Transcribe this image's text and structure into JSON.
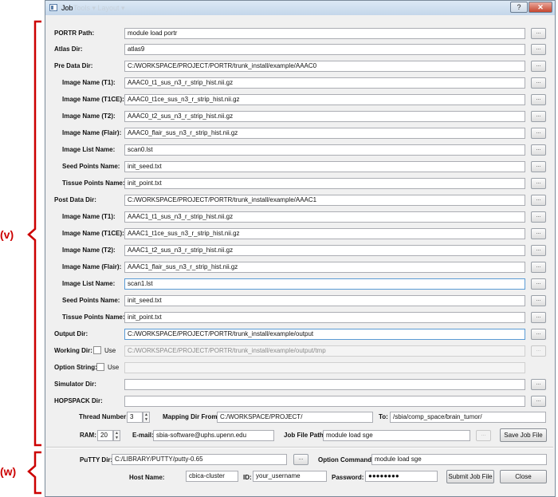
{
  "window": {
    "title": "Job",
    "ghost_menu": "Tools ▾  Layout ▾",
    "help_btn": "?",
    "close_btn": "✕"
  },
  "annotations": {
    "v": "(v)",
    "w": "(w)"
  },
  "browse_label": "...",
  "portr_path": {
    "label": "PORTR Path:",
    "value": "module load portr"
  },
  "atlas_dir": {
    "label": "Atlas Dir:",
    "value": "atlas9"
  },
  "pre_data": {
    "label": "Pre Data Dir:",
    "value": "C:/WORKSPACE/PROJECT/PORTR/trunk_install/example/AAAC0",
    "t1": {
      "label": "Image Name (T1):",
      "value": "AAAC0_t1_sus_n3_r_strip_hist.nii.gz"
    },
    "t1ce": {
      "label": "Image Name (T1CE):",
      "value": "AAAC0_t1ce_sus_n3_r_strip_hist.nii.gz"
    },
    "t2": {
      "label": "Image Name (T2):",
      "value": "AAAC0_t2_sus_n3_r_strip_hist.nii.gz"
    },
    "flair": {
      "label": "Image Name (Flair):",
      "value": "AAAC0_flair_sus_n3_r_strip_hist.nii.gz"
    },
    "list": {
      "label": "Image List Name:",
      "value": "scan0.lst"
    },
    "seed": {
      "label": "Seed Points Name:",
      "value": "init_seed.txt"
    },
    "tissue": {
      "label": "Tissue Points Name:",
      "value": "init_point.txt"
    }
  },
  "post_data": {
    "label": "Post Data Dir:",
    "value": "C:/WORKSPACE/PROJECT/PORTR/trunk_install/example/AAAC1",
    "t1": {
      "label": "Image Name (T1):",
      "value": "AAAC1_t1_sus_n3_r_strip_hist.nii.gz"
    },
    "t1ce": {
      "label": "Image Name (T1CE):",
      "value": "AAAC1_t1ce_sus_n3_r_strip_hist.nii.gz"
    },
    "t2": {
      "label": "Image Name (T2):",
      "value": "AAAC1_t2_sus_n3_r_strip_hist.nii.gz"
    },
    "flair": {
      "label": "Image Name (Flair):",
      "value": "AAAC1_flair_sus_n3_r_strip_hist.nii.gz"
    },
    "list": {
      "label": "Image List Name:",
      "value": "scan1.lst"
    },
    "seed": {
      "label": "Seed Points Name:",
      "value": "init_seed.txt"
    },
    "tissue": {
      "label": "Tissue Points Name:",
      "value": "init_point.txt"
    }
  },
  "output_dir": {
    "label": "Output Dir:",
    "value": "C:/WORKSPACE/PROJECT/PORTR/trunk_install/example/output"
  },
  "working_dir": {
    "label": "Working Dir:",
    "use_label": "Use",
    "value": "C:/WORKSPACE/PROJECT/PORTR/trunk_install/example/output/tmp"
  },
  "option_string": {
    "label": "Option String:",
    "use_label": "Use",
    "value": ""
  },
  "simulator_dir": {
    "label": "Simulator Dir:",
    "value": ""
  },
  "hopspack_dir": {
    "label": "HOPSPACK Dir:",
    "value": ""
  },
  "thread": {
    "label": "Thread Number:",
    "value": "3"
  },
  "mapping": {
    "from_label": "Mapping Dir From:",
    "from_value": "C:/WORKSPACE/PROJECT/",
    "to_label": "To:",
    "to_value": "/sbia/comp_space/brain_tumor/"
  },
  "ram": {
    "label": "RAM:",
    "value": "20"
  },
  "email": {
    "label": "E-mail:",
    "value": "sbia-software@uphs.upenn.edu"
  },
  "job_file": {
    "label": "Job File Path:",
    "value": "module load sge"
  },
  "save_job_button": "Save Job File",
  "putty": {
    "label": "PuTTY Dir:",
    "value": "C:/LIBRARY/PUTTY/putty-0.65"
  },
  "option_command": {
    "label": "Option Command:",
    "value": "module load sge"
  },
  "host": {
    "label": "Host Name:",
    "value": "cbica-cluster"
  },
  "id": {
    "label": "ID:",
    "value": "your_username"
  },
  "password": {
    "label": "Password:",
    "value": "●●●●●●●●"
  },
  "submit_button": "Submit Job File",
  "close_button": "Close",
  "colors": {
    "annotation": "#cc0000",
    "focus_border": "#5b9bd5"
  }
}
